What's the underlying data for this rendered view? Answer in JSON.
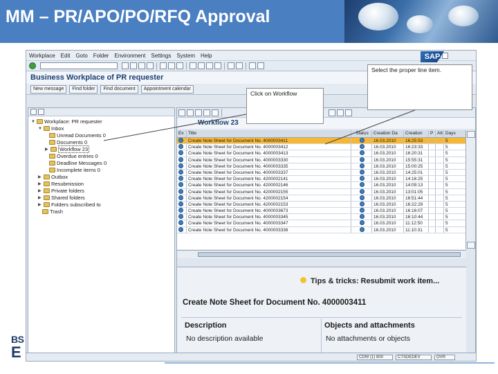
{
  "slide": {
    "title": "MM – PR/APO/PO/RFQ Approval"
  },
  "sap": {
    "menu": [
      "Workplace",
      "Edit",
      "Goto",
      "Folder",
      "Environment",
      "Settings",
      "System",
      "Help"
    ],
    "logo": "SAP",
    "app_title": "Business Workplace of PR requester",
    "app_buttons": [
      "New message",
      "Find folder",
      "Find document",
      "Appointment calendar"
    ],
    "tree": {
      "root": "Workplace: PR requester",
      "inbox": "Inbox",
      "inbox_items": [
        "Unread Documents 0",
        "Documents 0",
        "Workflow 23",
        "Overdue entries 0",
        "Deadline Messages 0",
        "Incomplete items 0"
      ],
      "other_items": [
        "Outbox",
        "Resubmission",
        "Private folders",
        "Shared folders",
        "Folders subscribed to",
        "Trash"
      ]
    },
    "worklist_title": "Workflow 23",
    "grid": {
      "headers": [
        "Ex",
        "Title",
        "Status",
        "Creation Da",
        "Creation",
        "P",
        "Att",
        "Days"
      ],
      "rows": [
        {
          "title": "Create Note Sheet for Document No. 4000003411",
          "date": "16.03.2010",
          "time": "16:25:53",
          "days": "5",
          "selected": true
        },
        {
          "title": "Create Note Sheet for Document No. 4000003412",
          "date": "16.03.2010",
          "time": "16:23:33",
          "days": "5",
          "selected": false
        },
        {
          "title": "Create Note Sheet for Document No. 4000003413",
          "date": "16.03.2010",
          "time": "16:20:31",
          "days": "5",
          "selected": false
        },
        {
          "title": "Create Note Sheet for Document No. 4000003330",
          "date": "16.03.2010",
          "time": "15:55:31",
          "days": "5",
          "selected": false
        },
        {
          "title": "Create Note Sheet for Document No. 4000003335",
          "date": "16.03.2010",
          "time": "15:00:25",
          "days": "5",
          "selected": false
        },
        {
          "title": "Create Note Sheet for Document No. 4000003337",
          "date": "16.03.2010",
          "time": "14:25:01",
          "days": "5",
          "selected": false
        },
        {
          "title": "Create Note Sheet for Document No. 4200002141",
          "date": "16.03.2010",
          "time": "14:16:25",
          "days": "5",
          "selected": false
        },
        {
          "title": "Create Note Sheet for Document No. 4200002146",
          "date": "16.03.2010",
          "time": "14:09:13",
          "days": "5",
          "selected": false
        },
        {
          "title": "Create Note Sheet for Document No. 4200002155",
          "date": "16.03.2010",
          "time": "13:01:05",
          "days": "5",
          "selected": false
        },
        {
          "title": "Create Note Sheet for Document No. 4200002154",
          "date": "16.03.2010",
          "time": "16:51:44",
          "days": "5",
          "selected": false
        },
        {
          "title": "Create Note Sheet for Document No. 4200002153",
          "date": "16.03.2010",
          "time": "16:22:29",
          "days": "5",
          "selected": false
        },
        {
          "title": "Create Note Sheet for Document No. 4000003673",
          "date": "16.03.2010",
          "time": "16:16:07",
          "days": "5",
          "selected": false
        },
        {
          "title": "Create Note Sheet for Document No. 4000003345",
          "date": "16.03.2010",
          "time": "16:10:44",
          "days": "5",
          "selected": false
        },
        {
          "title": "Create Note Sheet for Document No. 4000003347",
          "date": "16.03.2010",
          "time": "11:12:50",
          "days": "5",
          "selected": false
        },
        {
          "title": "Create Note Sheet for Document No. 4000003336",
          "date": "16.03.2010",
          "time": "11:10:31",
          "days": "5",
          "selected": false
        }
      ]
    },
    "preview": {
      "tips": "Tips & tricks:  Resubmit work item...",
      "title": "Create Note Sheet for Document No. 4000003411",
      "description_label": "Description",
      "description_value": "No description available",
      "objects_label": "Objects and attachments",
      "objects_value": "No attachments or objects"
    },
    "status": [
      "CDW (1) 800",
      "CTSDEDEV",
      "OVR"
    ]
  },
  "callouts": {
    "line_item": "Select the proper line item.",
    "workflow": "Click on Workflow"
  },
  "logo": {
    "bs": "BS",
    "e": "E"
  }
}
